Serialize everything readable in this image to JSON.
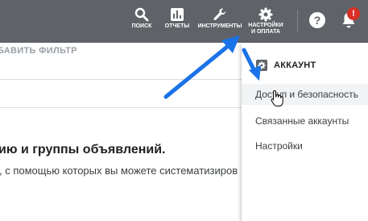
{
  "toolbar": {
    "search_label": "ПОИСК",
    "reports_label": "ОТЧЕТЫ",
    "tools_label": "ИНСТРУМЕНТЫ",
    "settings_label_line1": "НАСТРОЙКИ",
    "settings_label_line2": "И ОПЛАТА",
    "help_glyph": "?",
    "notification_glyph": "!"
  },
  "main": {
    "filter_label": "БАВИТЬ ФИЛЬТР",
    "heading": "ию и группы объявлений.",
    "description": ", с помощью которых вы можете систематизиров"
  },
  "menu": {
    "section_title": "АККАУНТ",
    "items": [
      {
        "label": "Доступ и безопасность"
      },
      {
        "label": "Связанные аккаунты"
      },
      {
        "label": "Настройки"
      }
    ]
  },
  "colors": {
    "topbar": "#5f6368",
    "annotation_arrow": "#1a73e8",
    "alert_badge": "#d93025"
  }
}
